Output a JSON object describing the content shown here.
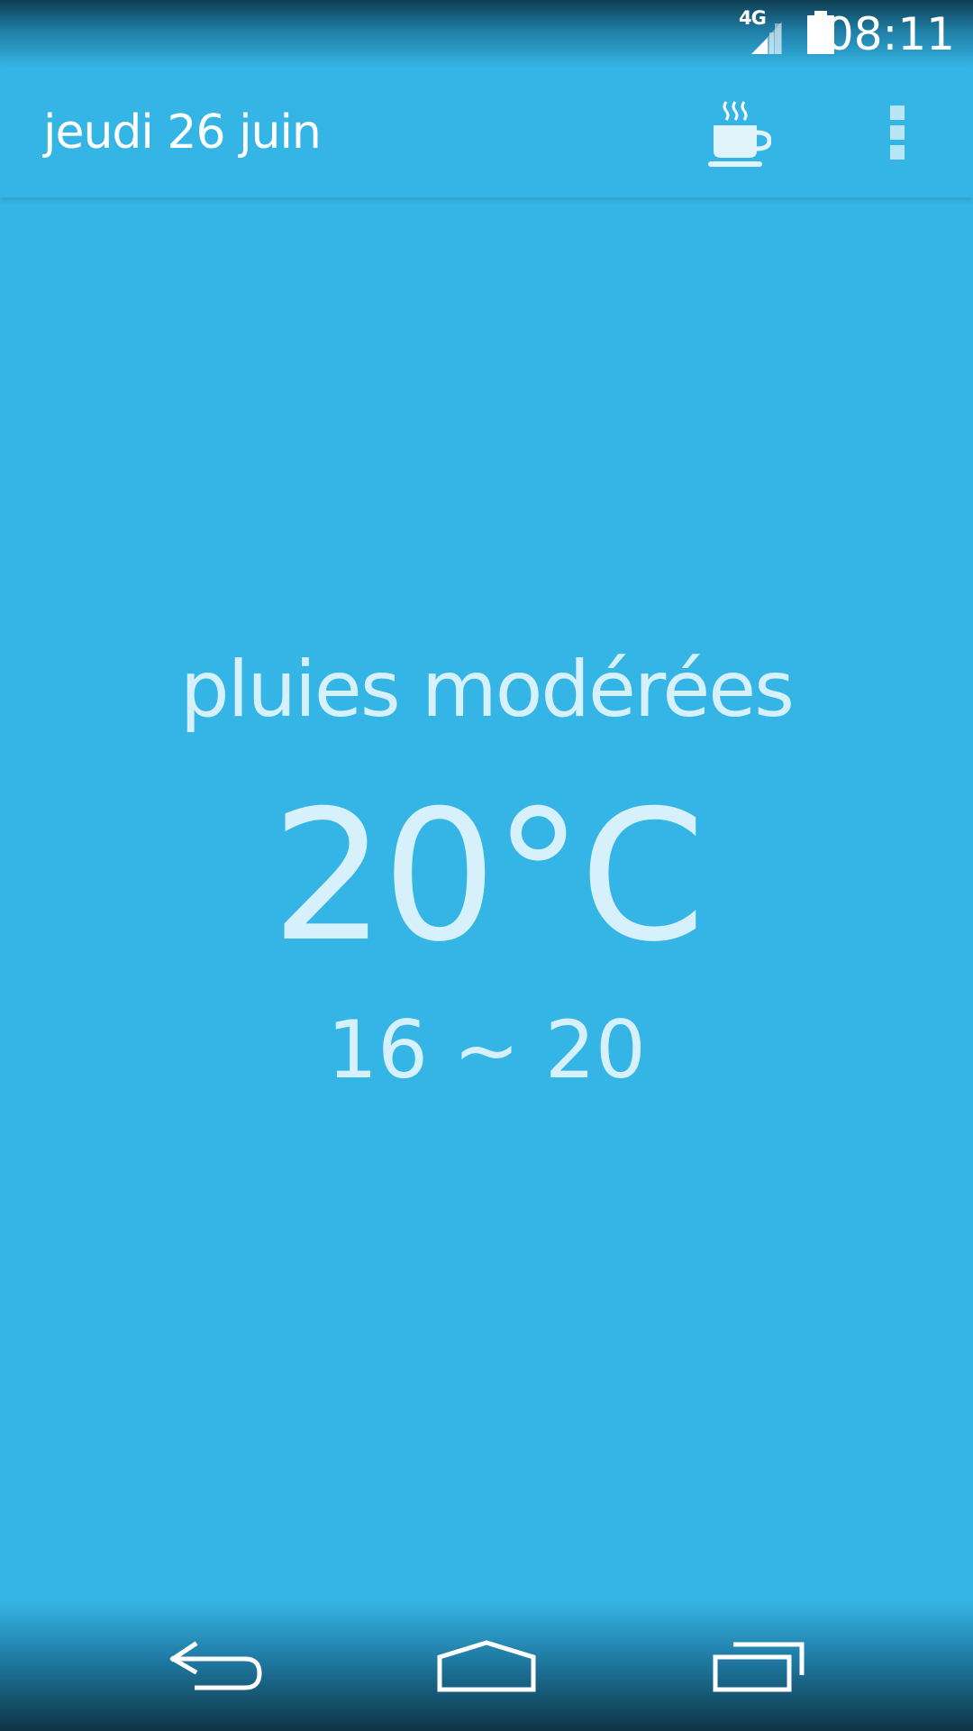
{
  "status_bar": {
    "network": "4G",
    "time": "08:11",
    "icons": [
      "signal-icon",
      "battery-icon"
    ]
  },
  "action_bar": {
    "title": "jeudi 26 juin",
    "actions": [
      "coffee-cup-icon",
      "overflow-menu-icon"
    ]
  },
  "weather": {
    "condition": "pluies modérées",
    "temperature": "20°C",
    "range": "16 ~ 20"
  },
  "nav_bar": {
    "buttons": [
      "back-icon",
      "home-icon",
      "recents-icon"
    ]
  },
  "colors": {
    "background": "#35b5e5",
    "text_primary": "#ffffff",
    "text_weather": "#d6f1fb"
  }
}
